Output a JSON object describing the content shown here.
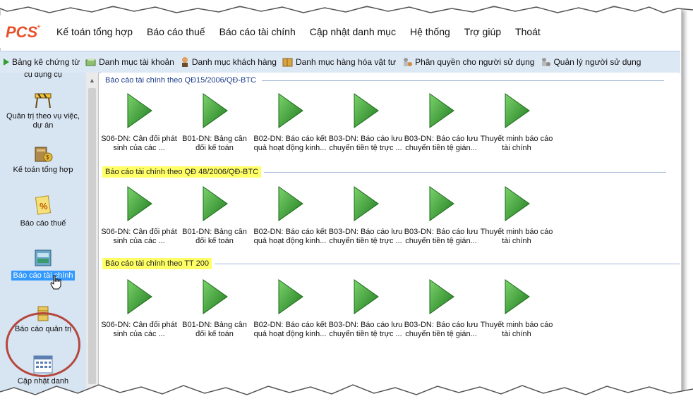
{
  "app": {
    "logo_text": "PCS"
  },
  "menu": [
    "Kế toán tổng hợp",
    "Báo cáo thuế",
    "Báo cáo tài chính",
    "Cập nhật danh mục",
    "Hệ thống",
    "Trợ giúp",
    "Thoát"
  ],
  "toolbar": [
    {
      "label": "Bảng kê chứng từ",
      "icon": "play-icon"
    },
    {
      "label": "Danh mục tài khoản",
      "icon": "accounts-icon"
    },
    {
      "label": "Danh mục khách hàng",
      "icon": "customer-icon"
    },
    {
      "label": "Danh mục hàng hóa vật tư",
      "icon": "goods-icon"
    },
    {
      "label": "Phân quyền cho người sử dụng",
      "icon": "permission-icon"
    },
    {
      "label": "Quản lý người sử dụng",
      "icon": "user-manage-icon"
    }
  ],
  "sidebar": {
    "items": [
      {
        "label": "cụ dụng cụ"
      },
      {
        "label": "Quản trị theo vụ việc, dự án"
      },
      {
        "label": "Kế toán tổng hợp"
      },
      {
        "label": "Báo cáo thuế"
      },
      {
        "label": "Báo cáo tài chính"
      },
      {
        "label": "Báo cáo quản trị"
      },
      {
        "label": "Cập nhật danh"
      }
    ]
  },
  "sections": [
    {
      "title": "Báo cáo tài chính theo QĐ15/2006/QĐ-BTC",
      "highlight": false,
      "tiles": [
        "S06-DN: Cân đối phát sinh của các ...",
        "B01-DN: Bảng cân đối kế toán",
        "B02-DN: Báo cáo kết quả hoạt động kinh...",
        "B03-DN: Báo cáo lưu chuyển tiền tệ trực ...",
        "B03-DN: Báo cáo lưu chuyển tiền tệ gián...",
        "Thuyết minh báo cáo tài chính"
      ]
    },
    {
      "title": "Báo cáo tài chính theo QĐ 48/2006/QĐ-BTC",
      "highlight": true,
      "tiles": [
        "S06-DN: Cân đối phát sinh của các ...",
        "B01-DN: Bảng cân đối kế toán",
        "B02-DN: Báo cáo kết quả hoạt động kinh...",
        "B03-DN: Báo cáo lưu chuyển tiền tệ trực ...",
        "B03-DN: Báo cáo lưu chuyển tiền tệ gián...",
        "Thuyết minh báo cáo tài chính"
      ]
    },
    {
      "title": "Báo cáo tài chính theo TT 200",
      "highlight": true,
      "tiles": [
        "S06-DN: Cân đối phát sinh của các ...",
        "B01-DN: Bảng cân đối kế toán",
        "B02-DN: Báo cáo kết quả hoạt động kinh...",
        "B03-DN: Báo cáo lưu chuyển tiền tệ trực ...",
        "B03-DN: Báo cáo lưu chuyển tiền tệ gián...",
        "Thuyết minh báo cáo tài chính"
      ]
    }
  ],
  "colors": {
    "toolbar_bg": "#dde8f5",
    "sidebar_bg": "#d7e4f2",
    "highlight": "#ffff66",
    "selection": "#3399ff",
    "annotation_circle": "#b5483e",
    "play_green": "#2e9e2e"
  }
}
